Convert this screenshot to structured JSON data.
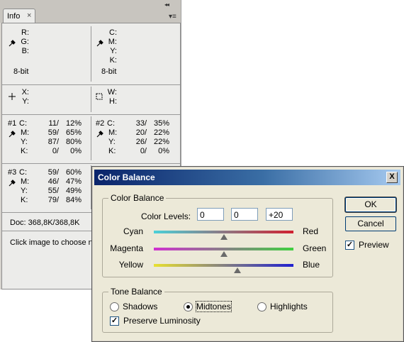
{
  "info_panel": {
    "tab_label": "Info",
    "tab_close": "×",
    "collapse_glyph": "◂◂",
    "menu_glyph": "▾≡",
    "rgb": {
      "labels": [
        "R:",
        "G:",
        "B:"
      ],
      "mode": "8-bit"
    },
    "cmyk": {
      "labels": [
        "C:",
        "M:",
        "Y:",
        "K:"
      ],
      "mode": "8-bit"
    },
    "position": {
      "x": "X:",
      "y": "Y:"
    },
    "size": {
      "w": "W:",
      "h": "H:"
    },
    "samplers": [
      {
        "id": "#1",
        "rows": [
          [
            "C:",
            "11/",
            "12%"
          ],
          [
            "M:",
            "59/",
            "65%"
          ],
          [
            "Y:",
            "87/",
            "80%"
          ],
          [
            "K:",
            "0/",
            "0%"
          ]
        ]
      },
      {
        "id": "#2",
        "rows": [
          [
            "C:",
            "33/",
            "35%"
          ],
          [
            "M:",
            "20/",
            "22%"
          ],
          [
            "Y:",
            "26/",
            "22%"
          ],
          [
            "K:",
            "0/",
            "0%"
          ]
        ]
      },
      {
        "id": "#3",
        "rows": [
          [
            "C:",
            "59/",
            "60%"
          ],
          [
            "M:",
            "46/",
            "47%"
          ],
          [
            "Y:",
            "55/",
            "49%"
          ],
          [
            "K:",
            "79/",
            "84%"
          ]
        ]
      }
    ],
    "doc_size": "Doc: 368,8K/368,8K",
    "hint": "Click image to choose ne"
  },
  "dialog": {
    "title": "Color Balance",
    "close_glyph": "X",
    "color_balance_group": "Color Balance",
    "color_levels_label": "Color Levels:",
    "levels": [
      "0",
      "0",
      "+20"
    ],
    "sliders": [
      {
        "left": "Cyan",
        "right": "Red",
        "value": 0,
        "gradient": [
          "#4ad0d8",
          "#d02030"
        ]
      },
      {
        "left": "Magenta",
        "right": "Green",
        "value": 0,
        "gradient": [
          "#d030d0",
          "#40d040"
        ]
      },
      {
        "left": "Yellow",
        "right": "Blue",
        "value": 20,
        "gradient": [
          "#e8e030",
          "#2020d0"
        ]
      }
    ],
    "tone_balance_group": "Tone Balance",
    "tones": [
      {
        "label": "Shadows",
        "selected": false
      },
      {
        "label": "Midtones",
        "selected": true
      },
      {
        "label": "Highlights",
        "selected": false
      }
    ],
    "preserve_luminosity": {
      "label": "Preserve Luminosity",
      "checked": true
    },
    "buttons": {
      "ok": "OK",
      "cancel": "Cancel"
    },
    "preview": {
      "label": "Preview",
      "checked": true
    }
  }
}
